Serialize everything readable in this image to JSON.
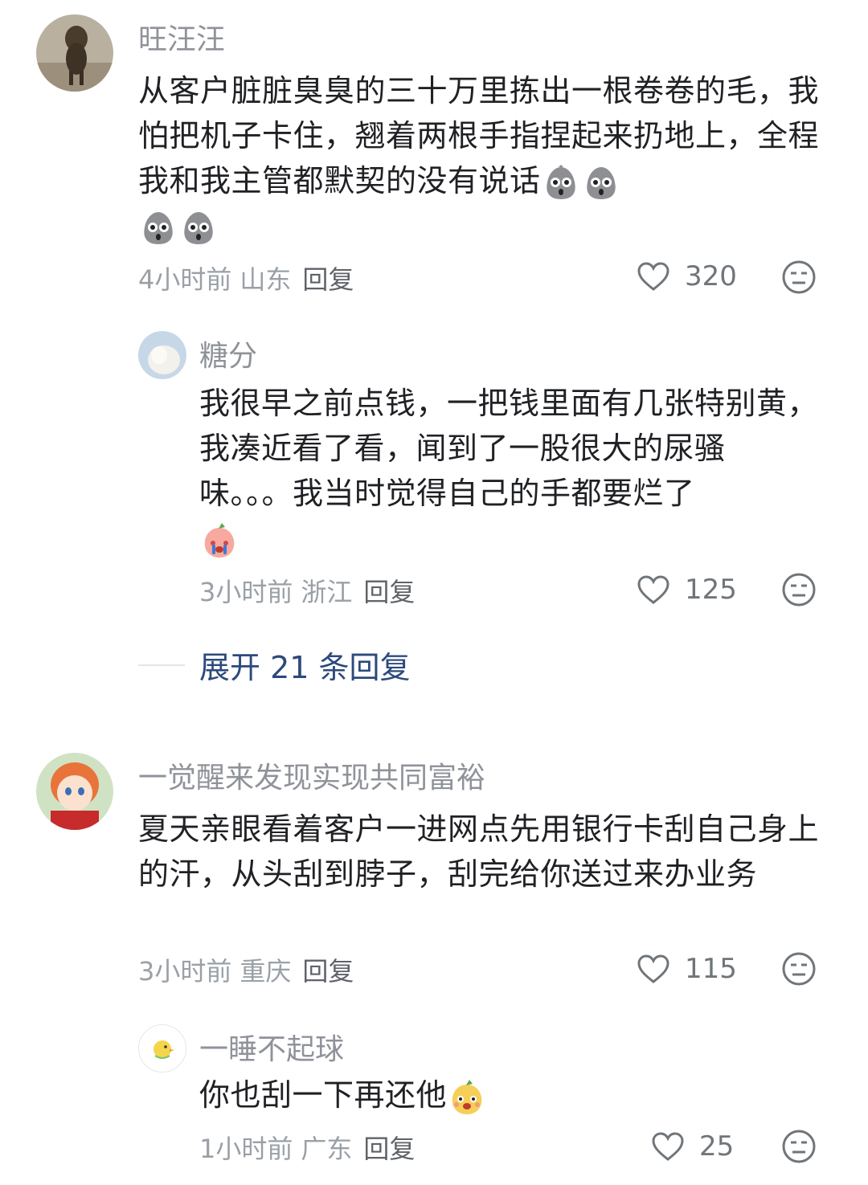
{
  "comments": [
    {
      "user": "旺汪汪",
      "text": "从客户脏脏臭臭的三十万里拣出一根卷卷的毛，我怕把机子卡住，翘着两根手指捏起来扔地上，全程我和我主管都默契的没有说话",
      "emojis": [
        "shocked-face-emoji",
        "shocked-face-emoji",
        "shocked-face-emoji",
        "shocked-face-emoji"
      ],
      "time": "4小时前",
      "location": "山东",
      "reply_label": "回复",
      "likes": "320"
    },
    {
      "user": "糖分",
      "text": "我很早之前点钱，一把钱里面有几张特别黄，我凑近看了看，闻到了一股很大的尿骚味。。。我当时觉得自己的手都要烂了",
      "emojis": [
        "crying-peach-emoji"
      ],
      "time": "3小时前",
      "location": "浙江",
      "reply_label": "回复",
      "likes": "125"
    },
    {
      "user": "一觉醒来发现实现共同富裕",
      "text": "夏天亲眼看着客户一进网点先用银行卡刮自己身上的汗，从头刮到脖子，刮完给你送过来办业务",
      "emojis": [],
      "time": "3小时前",
      "location": "重庆",
      "reply_label": "回复",
      "likes": "115"
    },
    {
      "user": "一睡不起球",
      "text": "你也刮一下再还他",
      "emojis": [
        "smiling-peach-emoji"
      ],
      "time": "1小时前",
      "location": "广东",
      "reply_label": "回复",
      "likes": "25"
    }
  ],
  "expand_replies": "展开 21 条回复",
  "colors": {
    "username": "#8f9399",
    "body": "#202124",
    "meta": "#9aa0a6",
    "expand_link": "#2c4a7c",
    "icon": "#70757a"
  }
}
